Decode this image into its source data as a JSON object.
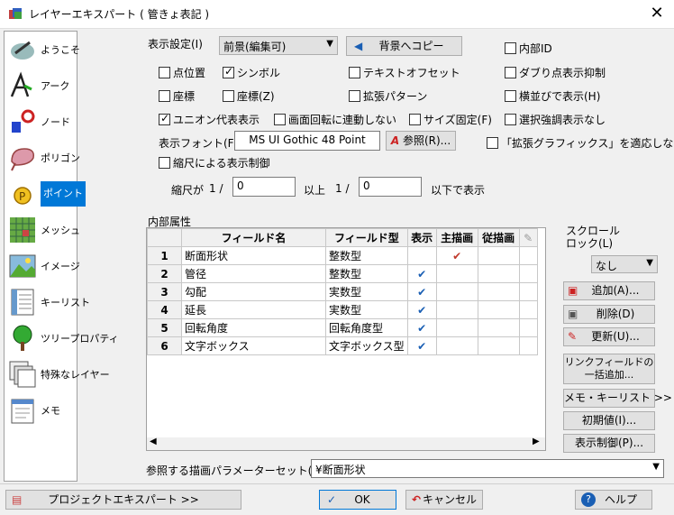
{
  "window": {
    "title": "レイヤーエキスパート ( 管きょ表記 )",
    "close": "✕"
  },
  "sidebar": {
    "items": [
      {
        "label": "ようこそ",
        "icon": "welcome-icon"
      },
      {
        "label": "アーク",
        "icon": "arc-icon"
      },
      {
        "label": "ノード",
        "icon": "node-icon"
      },
      {
        "label": "ポリゴン",
        "icon": "polygon-icon"
      },
      {
        "label": "ポイント",
        "icon": "point-icon"
      },
      {
        "label": "メッシュ",
        "icon": "mesh-icon"
      },
      {
        "label": "イメージ",
        "icon": "image-icon"
      },
      {
        "label": "キーリスト",
        "icon": "keylist-icon"
      },
      {
        "label": "ツリープロパティ",
        "icon": "tree-icon"
      },
      {
        "label": "特殊なレイヤー",
        "icon": "special-layer-icon"
      },
      {
        "label": "メモ",
        "icon": "memo-icon"
      }
    ],
    "selected_index": 4
  },
  "display": {
    "label": "表示設定(I)",
    "mode_value": "前景(編集可)",
    "copy_bg_button": "背景へコピー",
    "checkboxes": {
      "point_position": "点位置",
      "symbol": "シンボル",
      "text_offset": "テキストオフセット",
      "coords": "座標",
      "coords_z": "座標(Z)",
      "ext_pattern": "拡張パターン",
      "union_rep": "ユニオン代表表示",
      "screen_rotation": "画面回転に連動しない",
      "size_fixed": "サイズ固定(F)",
      "internal_id": "内部ID",
      "dup_suppress": "ダブり点表示抑制",
      "horizontal": "横並びで表示(H)",
      "selection_highlight": "選択強調表示なし",
      "no_ext_graphics": "「拡張グラフィックス」を適応しない",
      "scale_control": "縮尺による表示制御"
    },
    "font_label": "表示フォント(F)",
    "font_value": "MS UI Gothic 48 Point",
    "browse_button": "参照(R)...",
    "scale_prefix": "縮尺が",
    "one_slash": "1 /",
    "scale_min": "0",
    "above": "以上",
    "scale_max": "0",
    "below_show": "以下で表示"
  },
  "attributes": {
    "label": "内部属性",
    "headers": [
      "フィールド名",
      "フィールド型",
      "表示",
      "主描画",
      "従描画"
    ],
    "rows": [
      {
        "no": "1",
        "name": "断面形状",
        "type": "整数型",
        "show": "",
        "main": "✔",
        "sub": ""
      },
      {
        "no": "2",
        "name": "管径",
        "type": "整数型",
        "show": "✔",
        "main": "",
        "sub": ""
      },
      {
        "no": "3",
        "name": "勾配",
        "type": "実数型",
        "show": "✔",
        "main": "",
        "sub": ""
      },
      {
        "no": "4",
        "name": "延長",
        "type": "実数型",
        "show": "✔",
        "main": "",
        "sub": ""
      },
      {
        "no": "5",
        "name": "回転角度",
        "type": "回転角度型",
        "show": "✔",
        "main": "",
        "sub": ""
      },
      {
        "no": "6",
        "name": "文字ボックス",
        "type": "文字ボックス型",
        "show": "✔",
        "main": "",
        "sub": ""
      }
    ]
  },
  "right_panel": {
    "scroll_lock_label": "スクロール\nロック(L)",
    "scroll_lock_value": "なし",
    "add": "追加(A)...",
    "delete": "削除(D)",
    "update": "更新(U)...",
    "link_fields": "リンクフィールドの\n一括追加...",
    "memo_keylist": "メモ・キーリスト >>",
    "initial_value": "初期値(I)...",
    "display_control": "表示制御(P)..."
  },
  "param_set": {
    "label": "参照する描画パラメーターセット(P)",
    "value": "¥断面形状"
  },
  "footer": {
    "project_expert": "プロジェクトエキスパート >>",
    "ok": "OK",
    "cancel": "キャンセル",
    "help": "ヘルプ"
  }
}
